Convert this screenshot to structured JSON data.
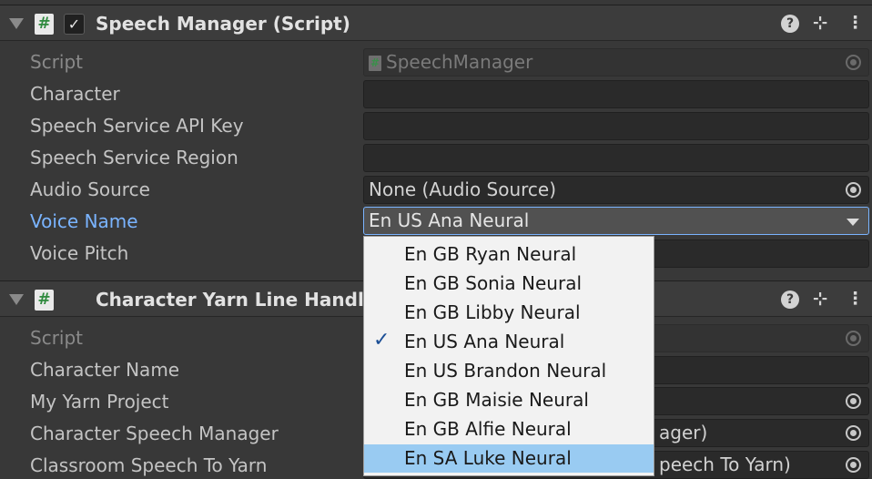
{
  "component1": {
    "title": "Speech Manager (Script)",
    "fields": [
      {
        "label": "Script",
        "value": "SpeechManager"
      },
      {
        "label": "Character",
        "value": ""
      },
      {
        "label": "Speech Service API Key",
        "value": ""
      },
      {
        "label": "Speech Service Region",
        "value": ""
      },
      {
        "label": "Audio Source",
        "value": "None (Audio Source)"
      },
      {
        "label": "Voice Name",
        "value": "En US Ana Neural"
      },
      {
        "label": "Voice Pitch",
        "value": ""
      }
    ]
  },
  "component2": {
    "title": "Character Yarn Line Handler (",
    "fields": [
      {
        "label": "Script",
        "value": ""
      },
      {
        "label": "Character Name",
        "value": ""
      },
      {
        "label": "My Yarn Project",
        "value": ""
      },
      {
        "label": "Character Speech Manager",
        "value": "ager)"
      },
      {
        "label": "Classroom Speech To Yarn",
        "value": "peech To Yarn)"
      }
    ]
  },
  "dropdown": {
    "selected": "En US Ana Neural",
    "hovered": "En SA Luke Neural",
    "options": [
      "En GB Ryan Neural",
      "En GB Sonia Neural",
      "En GB Libby Neural",
      "En US Ana Neural",
      "En US Brandon Neural",
      "En GB Maisie Neural",
      "En GB Alfie Neural",
      "En SA Luke Neural"
    ]
  },
  "icons": {
    "script": "#",
    "check": "✓",
    "help": "?",
    "presets": "⊹",
    "more": "⋮"
  },
  "colors": {
    "focus_label": "#7ab4ff",
    "highlight": "#99cbf2",
    "script_icon": "#2f8a3e"
  }
}
